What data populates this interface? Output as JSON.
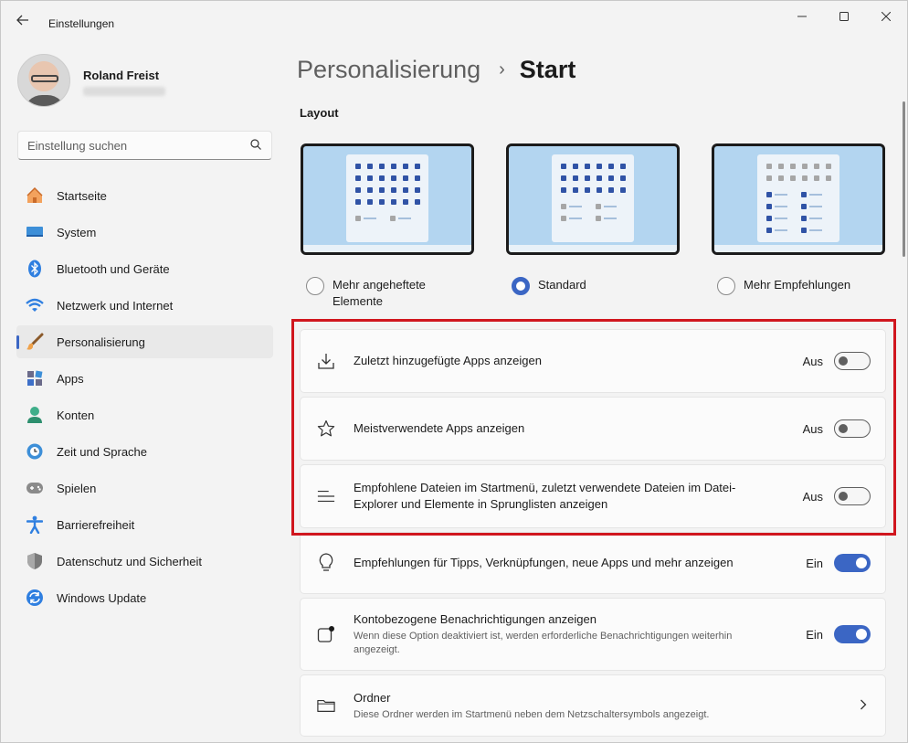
{
  "window": {
    "title": "Einstellungen"
  },
  "profile": {
    "name": "Roland Freist"
  },
  "search": {
    "placeholder": "Einstellung suchen"
  },
  "sidebar": {
    "items": [
      {
        "label": "Startseite",
        "icon": "home-icon"
      },
      {
        "label": "System",
        "icon": "monitor-icon"
      },
      {
        "label": "Bluetooth und Geräte",
        "icon": "bluetooth-icon"
      },
      {
        "label": "Netzwerk und Internet",
        "icon": "wifi-icon"
      },
      {
        "label": "Personalisierung",
        "icon": "brush-icon",
        "active": true
      },
      {
        "label": "Apps",
        "icon": "apps-icon"
      },
      {
        "label": "Konten",
        "icon": "person-icon"
      },
      {
        "label": "Zeit und Sprache",
        "icon": "clock-globe-icon"
      },
      {
        "label": "Spielen",
        "icon": "gamepad-icon"
      },
      {
        "label": "Barrierefreiheit",
        "icon": "accessibility-icon"
      },
      {
        "label": "Datenschutz und Sicherheit",
        "icon": "shield-icon"
      },
      {
        "label": "Windows Update",
        "icon": "update-icon"
      }
    ]
  },
  "header": {
    "parent": "Personalisierung",
    "separator": "›",
    "current": "Start"
  },
  "layout": {
    "title": "Layout",
    "options": [
      {
        "label_line1": "Mehr angeheftete",
        "label_line2": "Elemente",
        "selected": false
      },
      {
        "label_line1": "Standard",
        "label_line2": "",
        "selected": true
      },
      {
        "label_line1": "Mehr Empfehlungen",
        "label_line2": "",
        "selected": false
      }
    ]
  },
  "settings": [
    {
      "label": "Zuletzt hinzugefügte Apps anzeigen",
      "state": "Aus",
      "on": false,
      "icon": "download-icon"
    },
    {
      "label": "Meistverwendete Apps anzeigen",
      "state": "Aus",
      "on": false,
      "icon": "star-icon"
    },
    {
      "label_line1": "Empfohlene Dateien im Startmenü, zuletzt verwendete Dateien im Datei-",
      "label_line2": "Explorer und Elemente in Sprunglisten anzeigen",
      "state": "Aus",
      "on": false,
      "icon": "list-lines-icon"
    },
    {
      "label": "Empfehlungen für Tipps, Verknüpfungen, neue Apps und mehr anzeigen",
      "state": "Ein",
      "on": true,
      "icon": "lightbulb-icon"
    },
    {
      "label": "Kontobezogene Benachrichtigungen anzeigen",
      "sub_line1": "Wenn diese Option deaktiviert ist, werden erforderliche Benachrichtigungen weiterhin",
      "sub_line2": "angezeigt.",
      "state": "Ein",
      "on": true,
      "icon": "notification-badge-icon"
    },
    {
      "label": "Ordner",
      "sub": "Diese Ordner werden im Startmenü neben dem Netzschaltersymbols angezeigt.",
      "icon": "folder-icon"
    }
  ],
  "colors": {
    "accent": "#3b66c4",
    "highlight": "#d0161e",
    "background": "#f3f3f3"
  }
}
